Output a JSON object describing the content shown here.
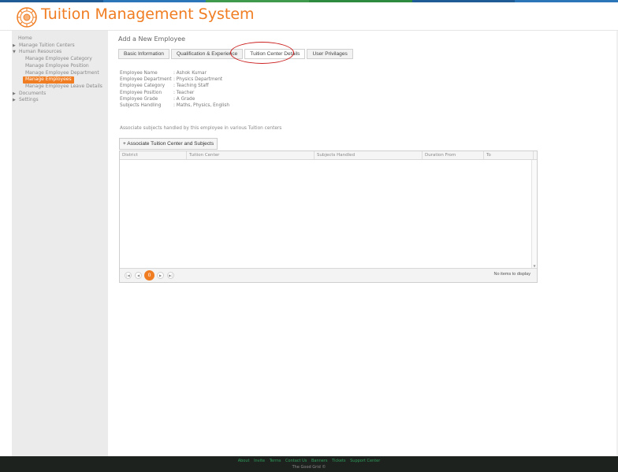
{
  "header": {
    "title": "Tuition Management System",
    "stripe_colors": [
      "#1f5c96",
      "#2a76b8",
      "#3f9a4e",
      "#2d8a3e",
      "#1f5c96",
      "#2a76b8"
    ]
  },
  "sidebar": {
    "items": [
      {
        "label": "Home"
      },
      {
        "label": "Manage Tuition Centers"
      },
      {
        "label": "Human Resources"
      },
      {
        "label": "Manage Employee Category"
      },
      {
        "label": "Manage Employee Position"
      },
      {
        "label": "Manage Employee Department"
      },
      {
        "label": "Manage Employees"
      },
      {
        "label": "Manage Employee Leave Details"
      },
      {
        "label": "Documents"
      },
      {
        "label": "Settings"
      }
    ]
  },
  "main": {
    "title": "Add a New Employee",
    "tabs": [
      {
        "label": "Basic Information"
      },
      {
        "label": "Qualification & Experience"
      },
      {
        "label": "Tuition Center Details"
      },
      {
        "label": "User Privilages"
      }
    ],
    "info": [
      {
        "key": "Employee Name",
        "value": ": Ashok Kumar"
      },
      {
        "key": "Employee Department",
        "value": ": Physics Department"
      },
      {
        "key": "Employee Category",
        "value": ": Teaching Staff"
      },
      {
        "key": "Employee Position",
        "value": ": Teacher"
      },
      {
        "key": "Employee Grade",
        "value": ": A Grade"
      },
      {
        "key": "Subjects Handling",
        "value": ": Maths, Physics, English"
      }
    ],
    "associate_text": "Associate subjects handled by this employee in various Tuition centers",
    "associate_button": "+ Associate Tuition Center and Subjects",
    "grid": {
      "columns": [
        "District",
        "Tuition Center",
        "Subjects Handled",
        "Duration From",
        "To"
      ],
      "current_page": "0",
      "status": "No items to display"
    }
  },
  "footer": {
    "links": [
      "About",
      "Invite",
      "Terms",
      "Contact Us",
      "Banners",
      "Tickets",
      "Support Center"
    ],
    "copyright": "The Good Grid ©"
  },
  "colors": {
    "accent": "#f07d22",
    "annotation": "#cc1f1f",
    "footer_link": "#2e9c58"
  }
}
